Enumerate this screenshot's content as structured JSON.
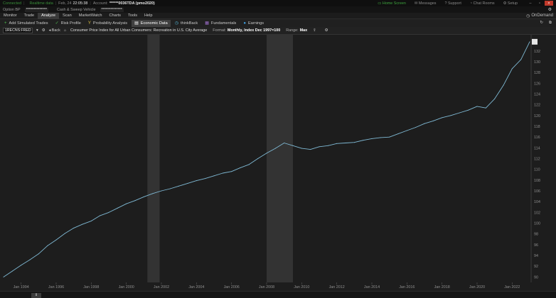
{
  "status": {
    "connected": "Connected",
    "data_mode": "Realtime data",
    "date": "Feb, 24",
    "time": "22:05:38",
    "account_label": "Account:",
    "account_value": "******0036TDA (pmo2020)",
    "links": [
      "Home Screen",
      "Messages",
      "Support",
      "Chat Rooms",
      "Setup"
    ]
  },
  "account_bar": {
    "option_bp_label": "Option BP",
    "option_bp_value": "**************",
    "cash_label": "Cash & Sweep Vehicle",
    "cash_value": "**************"
  },
  "tabs": [
    "Monitor",
    "Trade",
    "Analyze",
    "Scan",
    "MarketWatch",
    "Charts",
    "Tools",
    "Help"
  ],
  "active_tab": "Analyze",
  "ondemand": "OnDemand",
  "subtabs": [
    {
      "label": "Add Simulated Trades",
      "icon": "+"
    },
    {
      "label": "Risk Profile",
      "icon": "✓"
    },
    {
      "label": "Probability Analysis",
      "icon": "Y"
    },
    {
      "label": "Economic Data",
      "icon": "▤"
    },
    {
      "label": "thinkBack",
      "icon": "◷"
    },
    {
      "label": "Fundamentals",
      "icon": "▦"
    },
    {
      "label": "Earnings",
      "icon": "●"
    }
  ],
  "active_subtab": "Economic Data",
  "toolbar": {
    "symbol": "1RECNS:FRED",
    "back": "Back",
    "description": "Consumer Price Index for All Urban Consumers: Recreation in U.S. City Average",
    "format_label": "Format:",
    "format_value": "Monthly, Index Dec 1997=100",
    "range_label": "Range:",
    "range_value": "Max"
  },
  "colors": {
    "line": "#7fb9d4",
    "recession": "#333333",
    "background": "#1d1d1d"
  },
  "chart_data": {
    "type": "line",
    "ylim": [
      89,
      135
    ],
    "y_ticks": [
      90,
      92,
      94,
      96,
      98,
      100,
      102,
      104,
      106,
      108,
      110,
      112,
      114,
      116,
      118,
      120,
      122,
      124,
      126,
      128,
      130,
      132
    ],
    "x_ticks": [
      "Jan 1994",
      "Jan 1996",
      "Jan 1998",
      "Jan 2000",
      "Jan 2002",
      "Jan 2004",
      "Jan 2006",
      "Jan 2008",
      "Jan 2010",
      "Jan 2012",
      "Jan 2014",
      "Jan 2016",
      "Jan 2018",
      "Jan 2020",
      "Jan 2022"
    ],
    "recessions": [
      [
        2001.2,
        2001.9
      ],
      [
        2008.0,
        2009.5
      ]
    ],
    "series": [
      {
        "x": [
          1993.0,
          1993.5,
          1994.0,
          1994.5,
          1995.0,
          1995.5,
          1996.0,
          1996.5,
          1997.0,
          1997.5,
          1998.0,
          1998.5,
          1999.0,
          1999.5,
          2000.0,
          2000.5,
          2001.0,
          2001.5,
          2002.0,
          2002.5,
          2003.0,
          2003.5,
          2004.0,
          2004.5,
          2005.0,
          2005.5,
          2006.0,
          2006.5,
          2007.0,
          2007.5,
          2008.0,
          2008.5,
          2009.0,
          2009.5,
          2010.0,
          2010.5,
          2011.0,
          2011.5,
          2012.0,
          2012.5,
          2013.0,
          2013.5,
          2014.0,
          2014.5,
          2015.0,
          2015.5,
          2016.0,
          2016.5,
          2017.0,
          2017.5,
          2018.0,
          2018.5,
          2019.0,
          2019.5,
          2020.0,
          2020.5,
          2021.0,
          2021.5,
          2022.0,
          2022.5,
          2023.0
        ],
        "y": [
          90.0,
          91.1,
          92.2,
          93.2,
          94.3,
          95.8,
          96.9,
          98.1,
          99.1,
          99.8,
          100.4,
          101.4,
          102.0,
          102.8,
          103.6,
          104.2,
          104.9,
          105.5,
          106.0,
          106.4,
          106.9,
          107.4,
          107.9,
          108.3,
          108.8,
          109.3,
          109.6,
          110.3,
          110.9,
          112.0,
          113.0,
          113.9,
          114.9,
          114.4,
          113.9,
          113.7,
          114.2,
          114.4,
          114.8,
          114.9,
          115.0,
          115.4,
          115.7,
          115.9,
          116.0,
          116.6,
          117.2,
          117.8,
          118.5,
          119.0,
          119.6,
          120.0,
          120.5,
          121.0,
          121.7,
          121.4,
          123.1,
          125.6,
          128.7,
          130.4,
          133.7
        ]
      }
    ]
  }
}
